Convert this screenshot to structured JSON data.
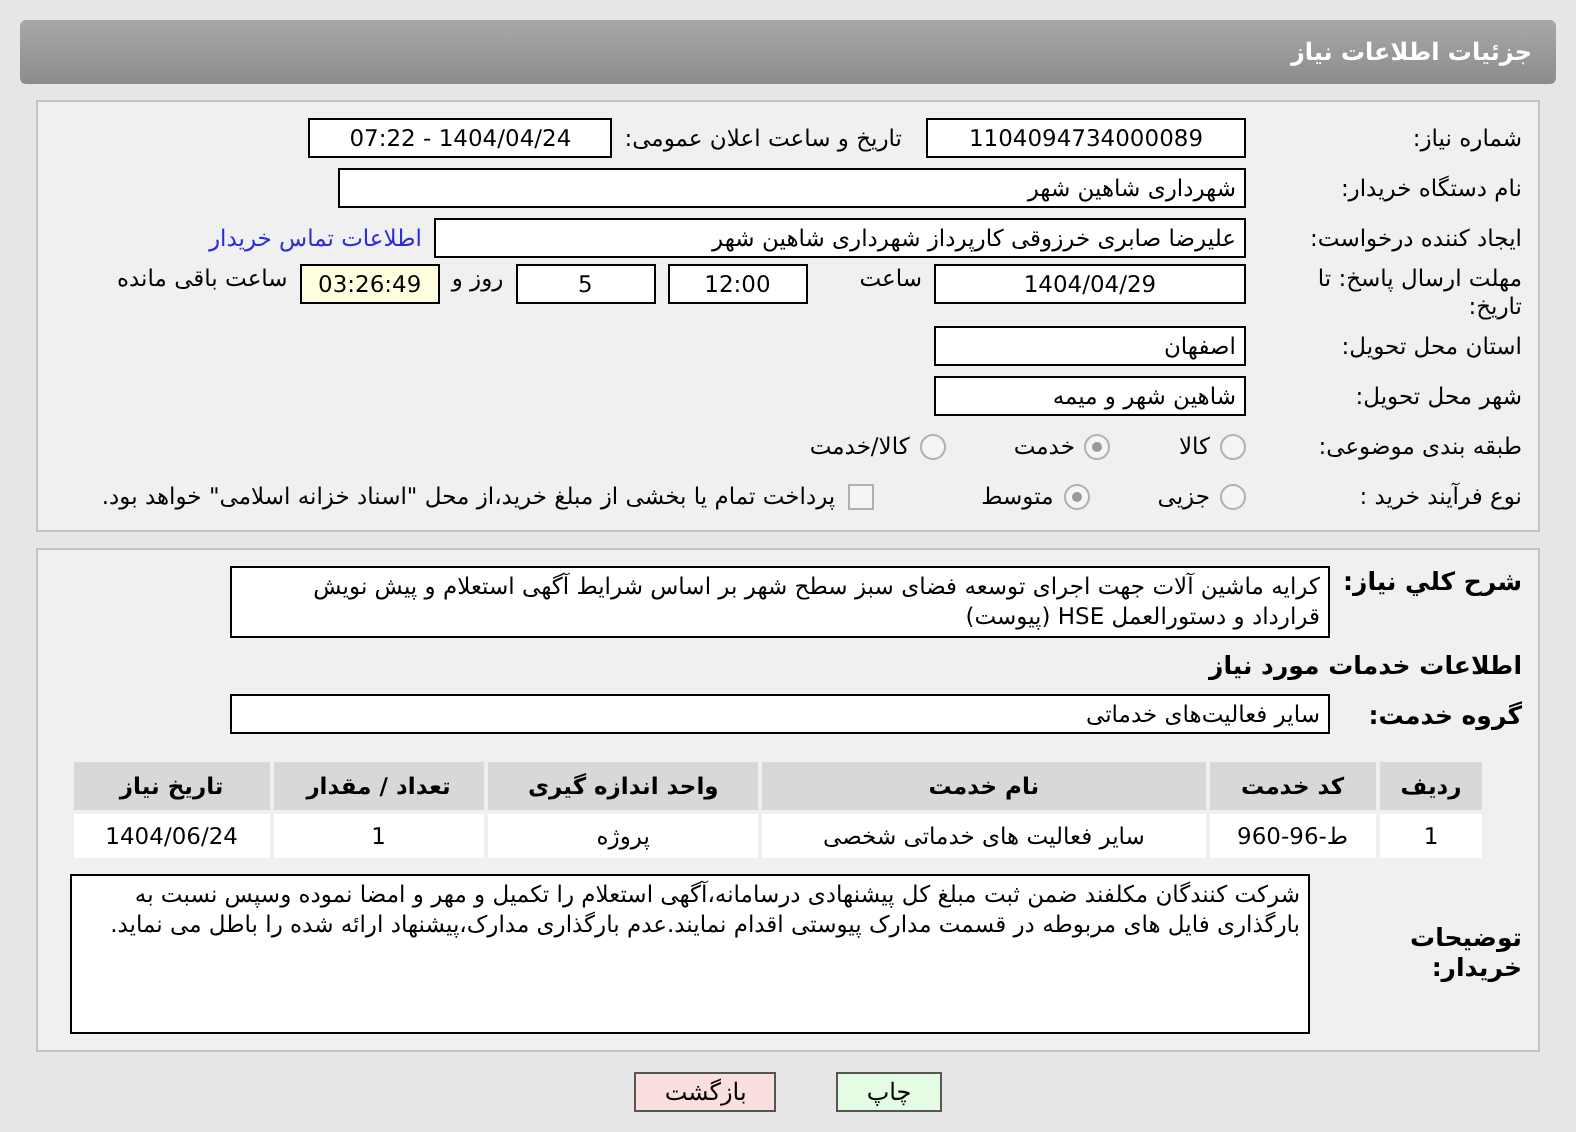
{
  "header": {
    "title": "جزئیات اطلاعات نیاز"
  },
  "need_number": {
    "label": "شماره نیاز:",
    "value": "1104094734000089"
  },
  "announce": {
    "label": "تاریخ و ساعت اعلان عمومی:",
    "value": "1404/04/24 - 07:22"
  },
  "buyer_org": {
    "label": "نام دستگاه خریدار:",
    "value": "شهرداری شاهین شهر"
  },
  "requester": {
    "label": "ایجاد کننده درخواست:",
    "value": "علیرضا صابری خرزوقی کارپرداز شهرداری شاهین شهر",
    "contact_link": "اطلاعات تماس خریدار"
  },
  "deadline": {
    "label": "مهلت ارسال پاسخ: تا تاریخ:",
    "date": "1404/04/29",
    "time_label": "ساعت",
    "time": "12:00",
    "days": "5",
    "days_label": "روز و",
    "remaining": "03:26:49",
    "remaining_label": "ساعت باقی مانده"
  },
  "province": {
    "label": "استان محل تحویل:",
    "value": "اصفهان"
  },
  "city": {
    "label": "شهر محل تحویل:",
    "value": "شاهین شهر و میمه"
  },
  "category": {
    "label": "طبقه بندی موضوعی:",
    "options": [
      {
        "label": "کالا",
        "selected": false
      },
      {
        "label": "خدمت",
        "selected": true
      },
      {
        "label": "کالا/خدمت",
        "selected": false
      }
    ]
  },
  "process": {
    "label": "نوع فرآیند خرید :",
    "options": [
      {
        "label": "جزیی",
        "selected": false
      },
      {
        "label": "متوسط",
        "selected": true
      }
    ],
    "payment": {
      "label": "پرداخت تمام یا بخشی از مبلغ خرید،از محل \"اسناد خزانه اسلامی\" خواهد بود.",
      "checked": false
    }
  },
  "description": {
    "label": "شرح کلي نياز:",
    "value": "کرایه ماشین آلات جهت اجرای توسعه فضای سبز سطح شهر بر اساس شرایط آگهی استعلام و پیش نویش قرارداد و دستورالعمل HSE (پیوست)"
  },
  "services_title": "اطلاعات خدمات مورد نیاز",
  "service_group": {
    "label": "گروه خدمت:",
    "value": "سایر فعالیت‌های خدماتی"
  },
  "table": {
    "columns": [
      "ردیف",
      "کد خدمت",
      "نام خدمت",
      "واحد اندازه گیری",
      "تعداد / مقدار",
      "تاریخ نیاز"
    ],
    "rows": [
      [
        "1",
        "ط-96-960",
        "سایر فعالیت های خدماتی شخصی",
        "پروژه",
        "1",
        "1404/06/24"
      ]
    ]
  },
  "buyer_notes": {
    "label": "توضیحات خریدار:",
    "value": "شرکت کنندگان مکلفند ضمن ثبت مبلغ کل پیشنهادی درسامانه،آگهی استعلام را  تکمیل و مهر و امضا نموده وسپس نسبت به بارگذاری فایل های مربوطه در قسمت مدارک پیوستی اقدام نمایند.عدم بارگذاری مدارک،پیشنهاد ارائه شده را باطل می نماید."
  },
  "buttons": [
    {
      "label": "چاپ",
      "kind": "print"
    },
    {
      "label": "بازگشت",
      "kind": "back"
    }
  ]
}
